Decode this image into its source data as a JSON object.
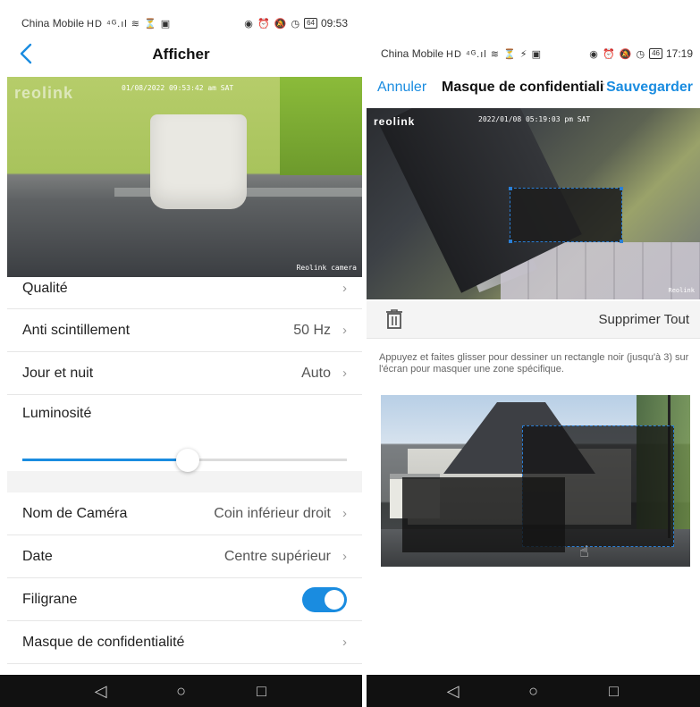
{
  "left": {
    "status": {
      "carrier": "China Mobile",
      "network_glyphs": "HD ⁴ᴳ.ıl ≋ ⏳ ▣",
      "icons": "◉ ⏰ 🔕 ◷",
      "battery": "64",
      "time": "09:53"
    },
    "header": {
      "back_icon": "chevron-left-icon",
      "title": "Afficher"
    },
    "camera": {
      "brand": "reolink",
      "timestamp": "01/08/2022 09:53:42 am SAT",
      "name": "Reolink camera"
    },
    "settings": {
      "quality": {
        "label": "Qualité"
      },
      "anti_flicker": {
        "label": "Anti scintillement",
        "value": "50 Hz"
      },
      "day_night": {
        "label": "Jour et nuit",
        "value": "Auto"
      },
      "brightness": {
        "label": "Luminosité",
        "level_percent": 51
      },
      "camera_name": {
        "label": "Nom de Caméra",
        "value": "Coin inférieur droit"
      },
      "date": {
        "label": "Date",
        "value": "Centre supérieur"
      },
      "watermark": {
        "label": "Filigrane",
        "enabled": true
      },
      "privacy_mask": {
        "label": "Masque de confidentialité"
      }
    },
    "navbar": {
      "back": "◁",
      "home": "○",
      "recent": "□"
    }
  },
  "right": {
    "status": {
      "carrier": "China Mobile",
      "network_glyphs": "HD ⁴ᴳ.ıl ≋ ⏳ ⚡ ▣",
      "icons": "◉ ⏰ 🔕 ◷",
      "battery": "46",
      "time": "17:19"
    },
    "header": {
      "cancel_label": "Annuler",
      "title": "Masque de confidentialité",
      "save_label": "Sauvegarder"
    },
    "camera": {
      "brand": "reolink",
      "timestamp": "2022/01/08 05:19:03 pm SAT",
      "name": "Reolink"
    },
    "toolbar": {
      "trash_icon": "trash-icon",
      "delete_all_label": "Supprimer Tout"
    },
    "instructions": "Appuyez et faites glisser pour dessiner un rectangle noir (jusqu'à 3) sur l'écran pour masquer une zone spécifique.",
    "navbar": {
      "back": "◁",
      "home": "○",
      "recent": "□"
    }
  },
  "colors": {
    "accent": "#1a8ce0",
    "navbar": "#111111"
  }
}
